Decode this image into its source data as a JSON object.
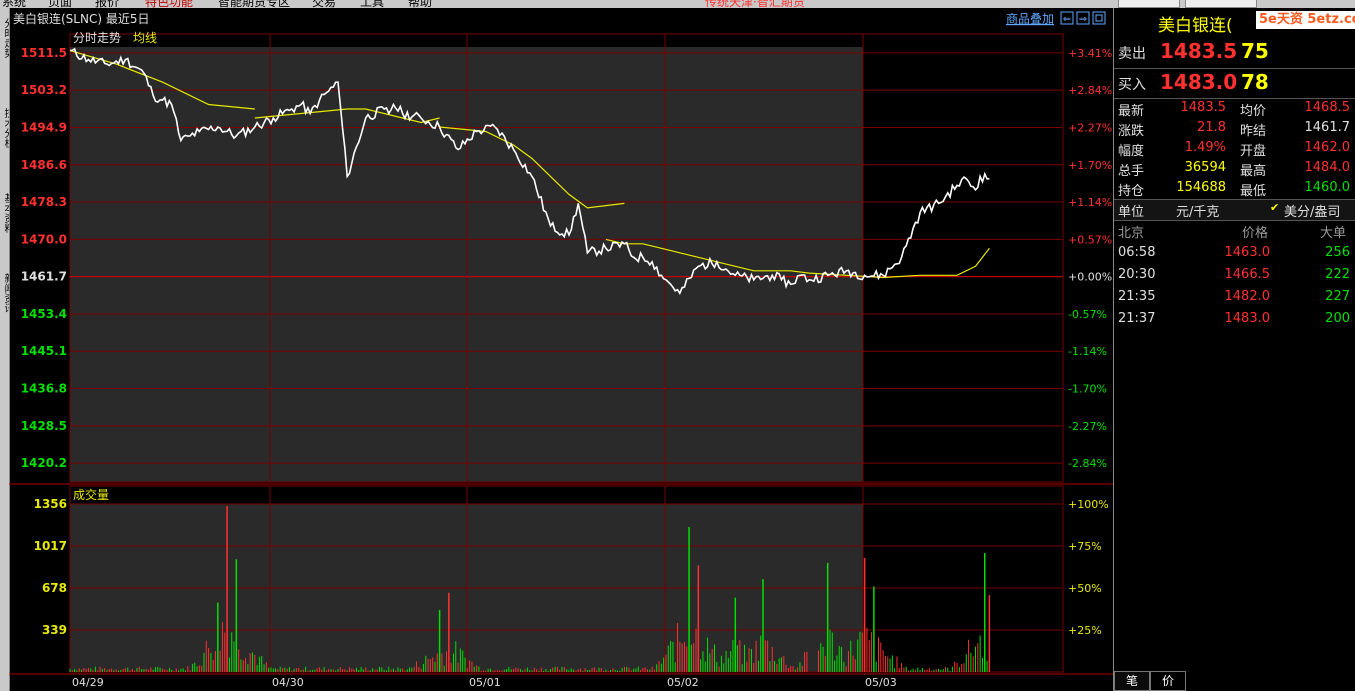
{
  "menu": [
    "系统",
    "页面",
    "报价",
    "特色功能",
    "智能期货专区",
    "交易",
    "工具",
    "帮助"
  ],
  "menu_marquee": " 传统天津·智汇期货",
  "leftstrip": [
    "分时走势",
    "技术分析",
    "基本资料",
    "新闻资讯"
  ],
  "chart_header": {
    "title": "美白银连(SLNC)  最近5日",
    "subtitle_left": "分时走势",
    "subtitle_avg": "均线",
    "overlay_btn": "商品叠加",
    "volume_label": "成交量"
  },
  "colors": {
    "up": "#ff3030",
    "down": "#00e000",
    "price_line": "#ffffff",
    "avg_line": "#e8e800",
    "grid": "#7a0000"
  },
  "chart_data": {
    "type": "line",
    "title": "美白银连(SLNC)  最近5日",
    "prev_close": 1461.7,
    "y_ticks": [
      "1511.5",
      "1503.2",
      "1494.9",
      "1486.6",
      "1478.3",
      "1470.0",
      "1461.7",
      "1453.4",
      "1445.1",
      "1436.8",
      "1428.5",
      "1420.2"
    ],
    "y_tick_values": [
      1511.5,
      1503.2,
      1494.9,
      1486.6,
      1478.3,
      1470.0,
      1461.7,
      1453.4,
      1445.1,
      1436.8,
      1428.5,
      1420.2
    ],
    "pct_ticks": [
      "+3.41%",
      "+2.84%",
      "+2.27%",
      "+1.70%",
      "+1.14%",
      "+0.57%",
      "+0.00%",
      "-0.57%",
      "-1.14%",
      "-1.70%",
      "-2.27%",
      "-2.84%"
    ],
    "ylim": [
      1416.0,
      1515.7
    ],
    "x_ticks": [
      "04/29",
      "04/30",
      "05/01",
      "05/02",
      "05/03"
    ],
    "x_range": [
      0,
      100
    ],
    "price_series": {
      "name": "分时走势",
      "x": [
        0,
        2,
        4,
        6,
        8,
        9,
        10,
        11,
        12,
        13,
        14,
        16,
        18,
        20,
        22,
        24,
        25,
        26,
        27,
        28,
        29,
        30,
        32,
        34,
        34.5,
        35,
        36,
        38,
        40,
        42,
        44,
        46,
        48,
        50,
        52,
        54,
        55,
        56,
        58,
        60,
        61,
        62,
        63,
        64,
        65,
        66,
        68,
        70,
        72,
        74,
        76,
        77,
        78,
        79,
        80,
        82,
        84,
        86,
        88,
        90,
        92,
        94,
        96,
        97,
        98,
        98.5,
        99.5
      ],
      "y": [
        1512,
        1510,
        1509,
        1510,
        1507,
        1502,
        1501,
        1500,
        1492,
        1493,
        1494,
        1495,
        1493,
        1495,
        1497,
        1499,
        1500,
        1498,
        1501,
        1503,
        1505,
        1484,
        1497,
        1499,
        1498,
        1500,
        1498,
        1497,
        1495,
        1490,
        1494,
        1495,
        1490,
        1484,
        1473,
        1471,
        1478,
        1467,
        1468,
        1469,
        1466,
        1466,
        1465,
        1462,
        1460,
        1458,
        1464,
        1465,
        1462,
        1461,
        1462,
        1461,
        1460,
        1462,
        1461,
        1462,
        1463,
        1462,
        1462,
        1466,
        1476,
        1478,
        1482,
        1483.5,
        1481,
        1484,
        1483.5
      ]
    },
    "avg_series": {
      "name": "均线",
      "segments": [
        {
          "x": [
            0,
            5,
            10,
            15,
            20
          ],
          "y": [
            1512,
            1509,
            1505,
            1500,
            1499
          ]
        },
        {
          "x": [
            20,
            25,
            30,
            32,
            34,
            36,
            38,
            40
          ],
          "y": [
            1497,
            1498,
            1499,
            1499,
            1498,
            1497,
            1496,
            1497
          ]
        },
        {
          "x": [
            40,
            45,
            48,
            50,
            52,
            54,
            56,
            60
          ],
          "y": [
            1495,
            1494,
            1491,
            1488,
            1484,
            1480,
            1477,
            1478
          ]
        },
        {
          "x": [
            58,
            60,
            62,
            64,
            66,
            68,
            70,
            72,
            74,
            76,
            78,
            80
          ],
          "y": [
            1470,
            1469,
            1469,
            1468,
            1467,
            1466,
            1465,
            1464,
            1463,
            1463,
            1463,
            1462.5
          ]
        },
        {
          "x": [
            80,
            84,
            88,
            92,
            96,
            98,
            99.5
          ],
          "y": [
            1462.5,
            1462,
            1461.5,
            1462,
            1462,
            1464,
            1468
          ]
        }
      ]
    },
    "volume": {
      "name": "成交量",
      "y_ticks": [
        "1356",
        "1017",
        "678",
        "339"
      ],
      "y_tick_values": [
        1356,
        1017,
        678,
        339
      ],
      "pct_ticks": [
        "+100%",
        "+75%",
        "+50%",
        "+25%"
      ],
      "ylim": [
        0,
        1356
      ],
      "peaks": [
        {
          "x": 17,
          "v": 1340,
          "c": "up"
        },
        {
          "x": 18,
          "v": 910,
          "c": "down"
        },
        {
          "x": 16,
          "v": 560,
          "c": "down"
        },
        {
          "x": 41,
          "v": 640,
          "c": "up"
        },
        {
          "x": 40,
          "v": 500,
          "c": "down"
        },
        {
          "x": 67,
          "v": 1170,
          "c": "down"
        },
        {
          "x": 68,
          "v": 860,
          "c": "up"
        },
        {
          "x": 72,
          "v": 600,
          "c": "down"
        },
        {
          "x": 75,
          "v": 750,
          "c": "down"
        },
        {
          "x": 82,
          "v": 880,
          "c": "down"
        },
        {
          "x": 86,
          "v": 920,
          "c": "up"
        },
        {
          "x": 87,
          "v": 690,
          "c": "down"
        },
        {
          "x": 99,
          "v": 960,
          "c": "down"
        },
        {
          "x": 99.5,
          "v": 620,
          "c": "up"
        }
      ]
    }
  },
  "right_panel": {
    "title": "美白银连(",
    "brand": "5e天资 5etz.com",
    "sell_label": "卖出",
    "sell_price": "1483.5",
    "sell_vol": "75",
    "buy_label": "买入",
    "buy_price": "1483.0",
    "buy_vol": "78",
    "stats": [
      {
        "l1": "最新",
        "v1": "1483.5",
        "c1": "red",
        "l2": "均价",
        "v2": "1468.5",
        "c2": "red"
      },
      {
        "l1": "涨跌",
        "v1": "21.8",
        "c1": "red",
        "l2": "昨结",
        "v2": "1461.7",
        "c2": "white"
      },
      {
        "l1": "幅度",
        "v1": "1.49%",
        "c1": "red",
        "l2": "开盘",
        "v2": "1462.0",
        "c2": "red"
      },
      {
        "l1": "总手",
        "v1": "36594",
        "c1": "yellow",
        "l2": "最高",
        "v2": "1484.0",
        "c2": "red"
      },
      {
        "l1": "持仓",
        "v1": "154688",
        "c1": "yellow",
        "l2": "最低",
        "v2": "1460.0",
        "c2": "green"
      }
    ],
    "unit_label": "单位",
    "unit_value": "元/千克",
    "unit_alt": "美分/盎司",
    "tick_header": {
      "time": "北京",
      "price": "价格",
      "vol": "大单"
    },
    "ticks": [
      {
        "time": "06:58",
        "price": "1463.0",
        "vol": "256"
      },
      {
        "time": "20:30",
        "price": "1466.5",
        "vol": "222"
      },
      {
        "time": "21:35",
        "price": "1482.0",
        "vol": "227"
      },
      {
        "time": "21:37",
        "price": "1483.0",
        "vol": "200"
      }
    ],
    "tab_bi": "笔",
    "tab_jia": "价"
  }
}
